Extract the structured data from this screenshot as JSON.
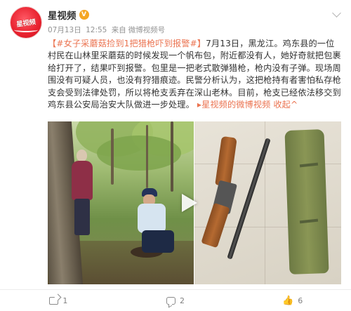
{
  "author": {
    "avatar_text": "星视频",
    "name": "星视频",
    "verified_badge": "V"
  },
  "meta": {
    "date": "07月13日",
    "time": "12:55",
    "source_prefix": "来自",
    "source_name": "微博视频号"
  },
  "post": {
    "topic_tag": "【#女子采蘑菇捡到1把猎枪吓到报警#】",
    "body": "7月13日，黑龙江。鸡东县的一位村民在山林里采蘑菇的时候发现一个帆布包，附近都没有人，她好奇就把包裹给打开了，结果吓到报警。包里是一把老式散弹猎枪，枪内没有子弹。现场周围没有可疑人员，也没有狩猎痕迹。民警分析认为，这把枪持有者害怕私存枪支会受到法律处罚，所以将枪支丢弃在深山老林。目前，枪支已经依法移交到鸡东县公安局治安大队做进一步处理。",
    "video_link": "星视频的微博视频",
    "collapse_link": "收起",
    "collapse_chevron": "^"
  },
  "media": {
    "left_image": "video-still-forest-woman-officer",
    "right_image": "shotgun-and-canvas-bag",
    "play_icon": "play-icon"
  },
  "footer": {
    "share_count": "1",
    "comment_count": "2",
    "like_count": "6"
  },
  "colors": {
    "link": "#eb7350",
    "text": "#333333",
    "meta": "#939393",
    "avatar_red": "#e8212e"
  }
}
